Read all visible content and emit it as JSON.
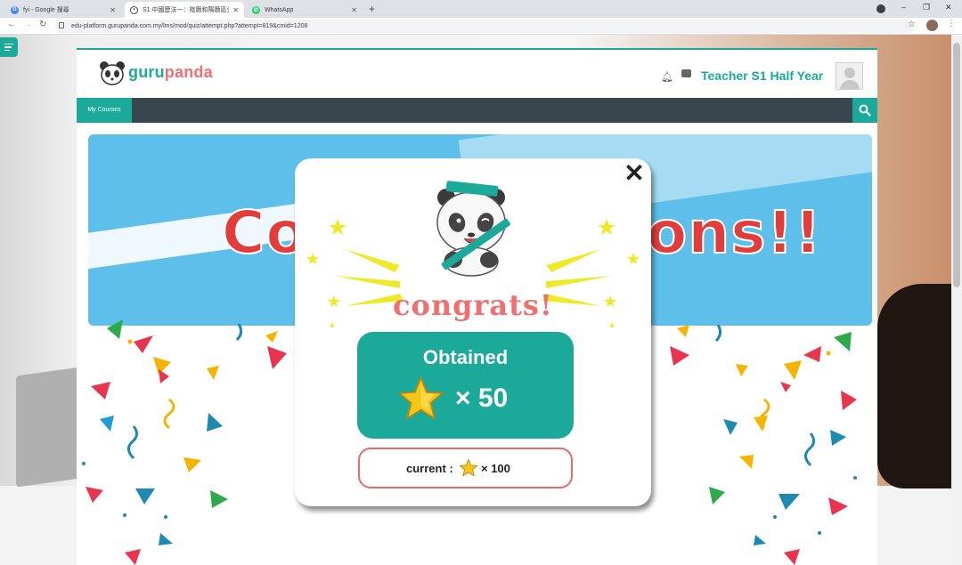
{
  "browser": {
    "tabs": [
      {
        "title": "fyi - Google 搜尋",
        "icon": "google-icon",
        "color": "#4285f4"
      },
      {
        "title": "S1 中國歷法一：陰曆和陽曆區分",
        "icon": "gurupanda-icon",
        "color": "#444444"
      },
      {
        "title": "WhatsApp",
        "icon": "whatsapp-icon",
        "color": "#25d366"
      }
    ],
    "new_tab_symbol": "+",
    "url": "edu-platform.gurupanda.com.my/lms/mod/quiz/attempt.php?attempt=819&cmid=1208",
    "window_controls": {
      "minimize": "–",
      "maximize": "❐",
      "close": "✕"
    }
  },
  "site": {
    "logo_part1": "guru",
    "logo_part2": "panda",
    "user_name": "Teacher S1 Half Year",
    "nav_my_courses": "My Courses"
  },
  "banner": {
    "text": "Congratulations!!"
  },
  "modal": {
    "close_symbol": "✕",
    "congrats_text": "congrats!",
    "obtained_label": "Obtained",
    "obtained_multiplier": "× 50",
    "obtained_count": 50,
    "current_label": "current :",
    "current_multiplier": "× 100",
    "current_count": 100
  },
  "colors": {
    "brand_teal": "#1ba99a",
    "brand_coral": "#f06f6f",
    "navbar_dark": "#3a464d",
    "banner_blue": "#5ec0ea",
    "star_yellow": "#f5c518",
    "burst_yellow": "#eeea2a"
  }
}
